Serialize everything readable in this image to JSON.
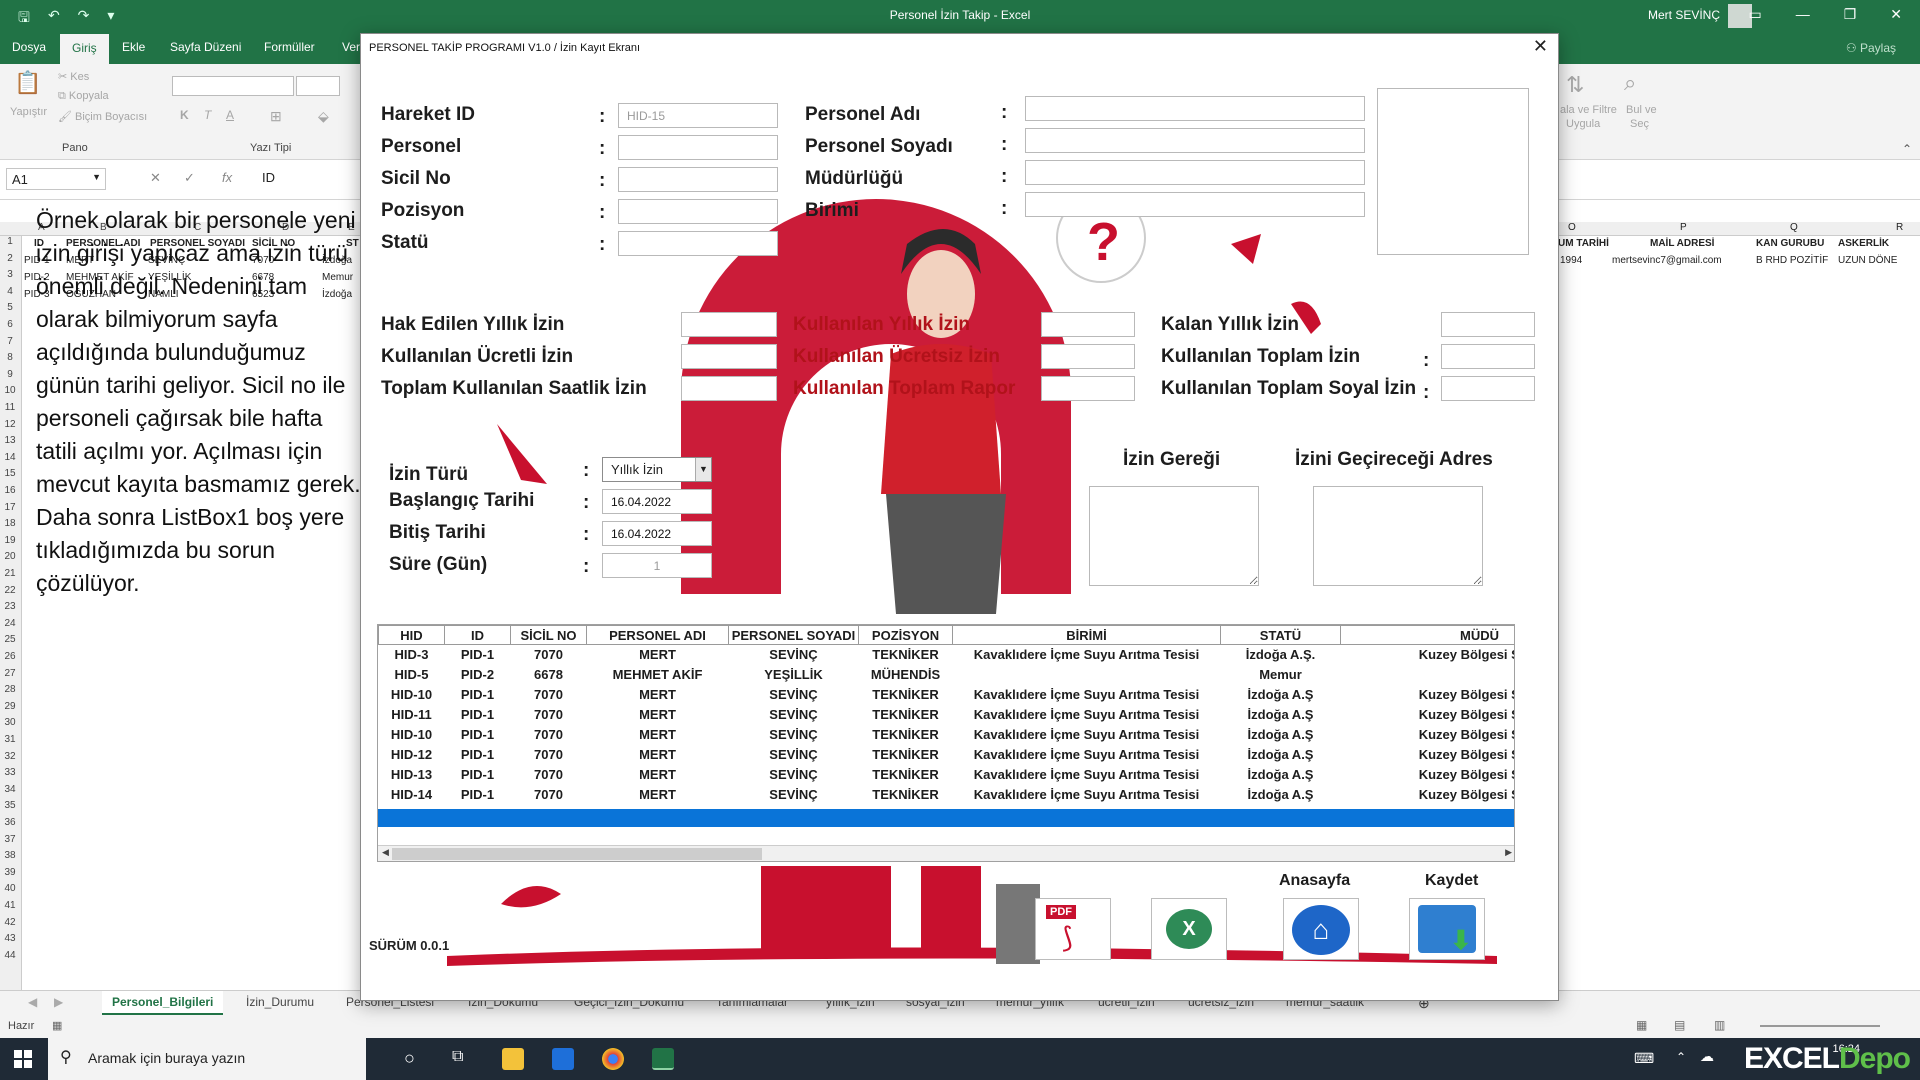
{
  "excel": {
    "window_title": "Personel İzin Takip  -  Excel",
    "user_name": "Mert SEVİNÇ",
    "share_label": "Paylaş",
    "tabs": [
      "Dosya",
      "Giriş",
      "Ekle",
      "Sayfa Düzeni",
      "Formüller",
      "Ver"
    ],
    "ribbon": {
      "paste": "Yapıştır",
      "cut": "Kes",
      "copy": "Kopyala",
      "format_painter": "Biçim Boyacısı",
      "group_clipboard": "Pano",
      "group_font": "Yazı Tipi",
      "sort_filter": "ala ve Filtre",
      "sort_apply": "Uygula",
      "find": "Bul ve",
      "find_select": "Seç"
    },
    "name_box": "A1",
    "formula_value": "ID",
    "columns_left": [
      "A",
      "B",
      "C",
      "D",
      "E"
    ],
    "header_row": [
      "ID",
      "PERSONEL ADI",
      "PERSONEL SOYADI",
      "SİCİL NO",
      "ST"
    ],
    "rows_left": [
      [
        "PID-1",
        "MERT",
        "SEVİNÇ",
        "7070",
        "İzdoğa"
      ],
      [
        "PID-2",
        "MEHMET AKİF",
        "YEŞİLLİK",
        "6678",
        "Memur"
      ],
      [
        "PID-3",
        "OĞUZHAN",
        "NAMLI",
        "6523",
        "İzdoğa"
      ]
    ],
    "row_numbers": [
      "1",
      "2",
      "3",
      "4",
      "5",
      "6",
      "7",
      "8",
      "9",
      "10",
      "11",
      "12",
      "13",
      "14",
      "15",
      "16",
      "17",
      "18",
      "19",
      "20",
      "21",
      "22",
      "23",
      "24",
      "25",
      "26",
      "27",
      "28",
      "29",
      "30",
      "31",
      "32",
      "33",
      "34",
      "35",
      "36",
      "37",
      "38",
      "39",
      "40",
      "41",
      "42",
      "43",
      "44"
    ],
    "columns_right": [
      "O",
      "P",
      "Q",
      "R"
    ],
    "header_right": [
      "UM TARİHİ",
      "MAİL ADRESİ",
      "KAN GURUBU",
      "ASKERLİK"
    ],
    "row_right": [
      "1994",
      "mertsevinc7@gmail.com",
      "B RHD POZİTİF",
      "UZUN DÖNE"
    ],
    "note_text": "Örnek olarak bir personele yeni izin girişi yapıcaz ama izin türü önemli değil. Nedenini tam olarak bilmiyorum sayfa açıldığında bulunduğumuz günün tarihi geliyor. Sicil no ile personeli çağırsak bile hafta tatili açılmı yor. Açılması için mevcut kayıta basmamız gerek. Daha sonra ListBox1 boş yere tıkladığımızda bu sorun çözülüyor.",
    "sheet_tabs": [
      "Personel_Bilgileri",
      "İzin_Durumu",
      "Personel_Listesi",
      "İzin_Dökümü",
      "Geçici_İzin_Dökümü",
      "Tanımlamalar",
      "yıllık_izin",
      "sosyal_izin",
      "memur_yıllık",
      "ücretli_izin",
      "ücretsiz_izin",
      "memur_saatlik"
    ],
    "status_ready": "Hazır"
  },
  "taskbar": {
    "search_placeholder": "Aramak için buraya yazın",
    "time": "16:24",
    "brand_a": "EXCEL",
    "brand_b": "Depo"
  },
  "dialog": {
    "title": "PERSONEL TAKİP PROGRAMI V1.0 / İzin Kayıt Ekranı",
    "labels": {
      "hareket_id": "Hareket ID",
      "personel": "Personel",
      "sicil_no": "Sicil No",
      "pozisyon": "Pozisyon",
      "statu": "Statü",
      "personel_adi": "Personel Adı",
      "personel_soyadi": "Personel Soyadı",
      "mudurlugu": "Müdürlüğü",
      "birimi": "Birimi",
      "hak_edilen": "Hak Edilen Yıllık İzin",
      "kullanilan_ucretli": "Kullanılan Ücretli İzin",
      "toplam_saatlik": "Toplam Kullanılan Saatlik İzin",
      "kullanilan_yillik": "Kullanılan Yıllık İzin",
      "kullanilan_ucretsiz": "Kullanılan Ücretsiz İzin",
      "kullanilan_rapor": "Kullanılan Toplam Rapor",
      "kalan_yillik": "Kalan Yıllık İzin",
      "kullanilan_toplam": "Kullanılan Toplam İzin",
      "kullanilan_soyal": "Kullanılan Toplam Soyal İzin",
      "izin_turu": "İzin Türü",
      "baslangic": "Başlangıç Tarihi",
      "bitis": "Bitiş Tarihi",
      "sure": "Süre (Gün)",
      "izin_geregi": "İzin Gereği",
      "izin_adres": "İzini Geçireceği Adres",
      "colon": ":"
    },
    "values": {
      "hareket_id": "HID-15",
      "izin_turu": "Yıllık İzin",
      "baslangic": "16.04.2022",
      "bitis": "16.04.2022",
      "sure": "1"
    },
    "list": {
      "headers": [
        "HID",
        "ID",
        "SİCİL NO",
        "PERSONEL ADI",
        "PERSONEL SOYADI",
        "POZİSYON",
        "BİRİMİ",
        "STATÜ",
        "MÜDÜ"
      ],
      "rows": [
        [
          "HID-3",
          "PID-1",
          "7070",
          "MERT",
          "SEVİNÇ",
          "TEKNİKER",
          "Kavaklıdere İçme Suyu Arıtma Tesisi",
          "İzdoğa A.Ş.",
          "Kuzey Bölgesi Su A"
        ],
        [
          "HID-5",
          "PID-2",
          "6678",
          "MEHMET AKİF",
          "YEŞİLLİK",
          "MÜHENDİS",
          "",
          "Memur",
          ""
        ],
        [
          "HID-10",
          "PID-1",
          "7070",
          "MERT",
          "SEVİNÇ",
          "TEKNİKER",
          "Kavaklıdere İçme Suyu Arıtma Tesisi",
          "İzdoğa A.Ş",
          "Kuzey Bölgesi Su A"
        ],
        [
          "HID-11",
          "PID-1",
          "7070",
          "MERT",
          "SEVİNÇ",
          "TEKNİKER",
          "Kavaklıdere İçme Suyu Arıtma Tesisi",
          "İzdoğa A.Ş",
          "Kuzey Bölgesi Su A"
        ],
        [
          "HID-10",
          "PID-1",
          "7070",
          "MERT",
          "SEVİNÇ",
          "TEKNİKER",
          "Kavaklıdere İçme Suyu Arıtma Tesisi",
          "İzdoğa A.Ş",
          "Kuzey Bölgesi Su A"
        ],
        [
          "HID-12",
          "PID-1",
          "7070",
          "MERT",
          "SEVİNÇ",
          "TEKNİKER",
          "Kavaklıdere İçme Suyu Arıtma Tesisi",
          "İzdoğa A.Ş",
          "Kuzey Bölgesi Su A"
        ],
        [
          "HID-13",
          "PID-1",
          "7070",
          "MERT",
          "SEVİNÇ",
          "TEKNİKER",
          "Kavaklıdere İçme Suyu Arıtma Tesisi",
          "İzdoğa A.Ş",
          "Kuzey Bölgesi Su A"
        ],
        [
          "HID-14",
          "PID-1",
          "7070",
          "MERT",
          "SEVİNÇ",
          "TEKNİKER",
          "Kavaklıdere İçme Suyu Arıtma Tesisi",
          "İzdoğa A.Ş",
          "Kuzey Bölgesi Su A"
        ]
      ]
    },
    "buttons": {
      "home": "Anasayfa",
      "save": "Kaydet",
      "pdf_text": "PDF"
    },
    "version": "SÜRÜM 0.0.1",
    "colors": {
      "accent_red": "#c8102e",
      "excel_green": "#217346",
      "selection_blue": "#0a74d8"
    }
  }
}
